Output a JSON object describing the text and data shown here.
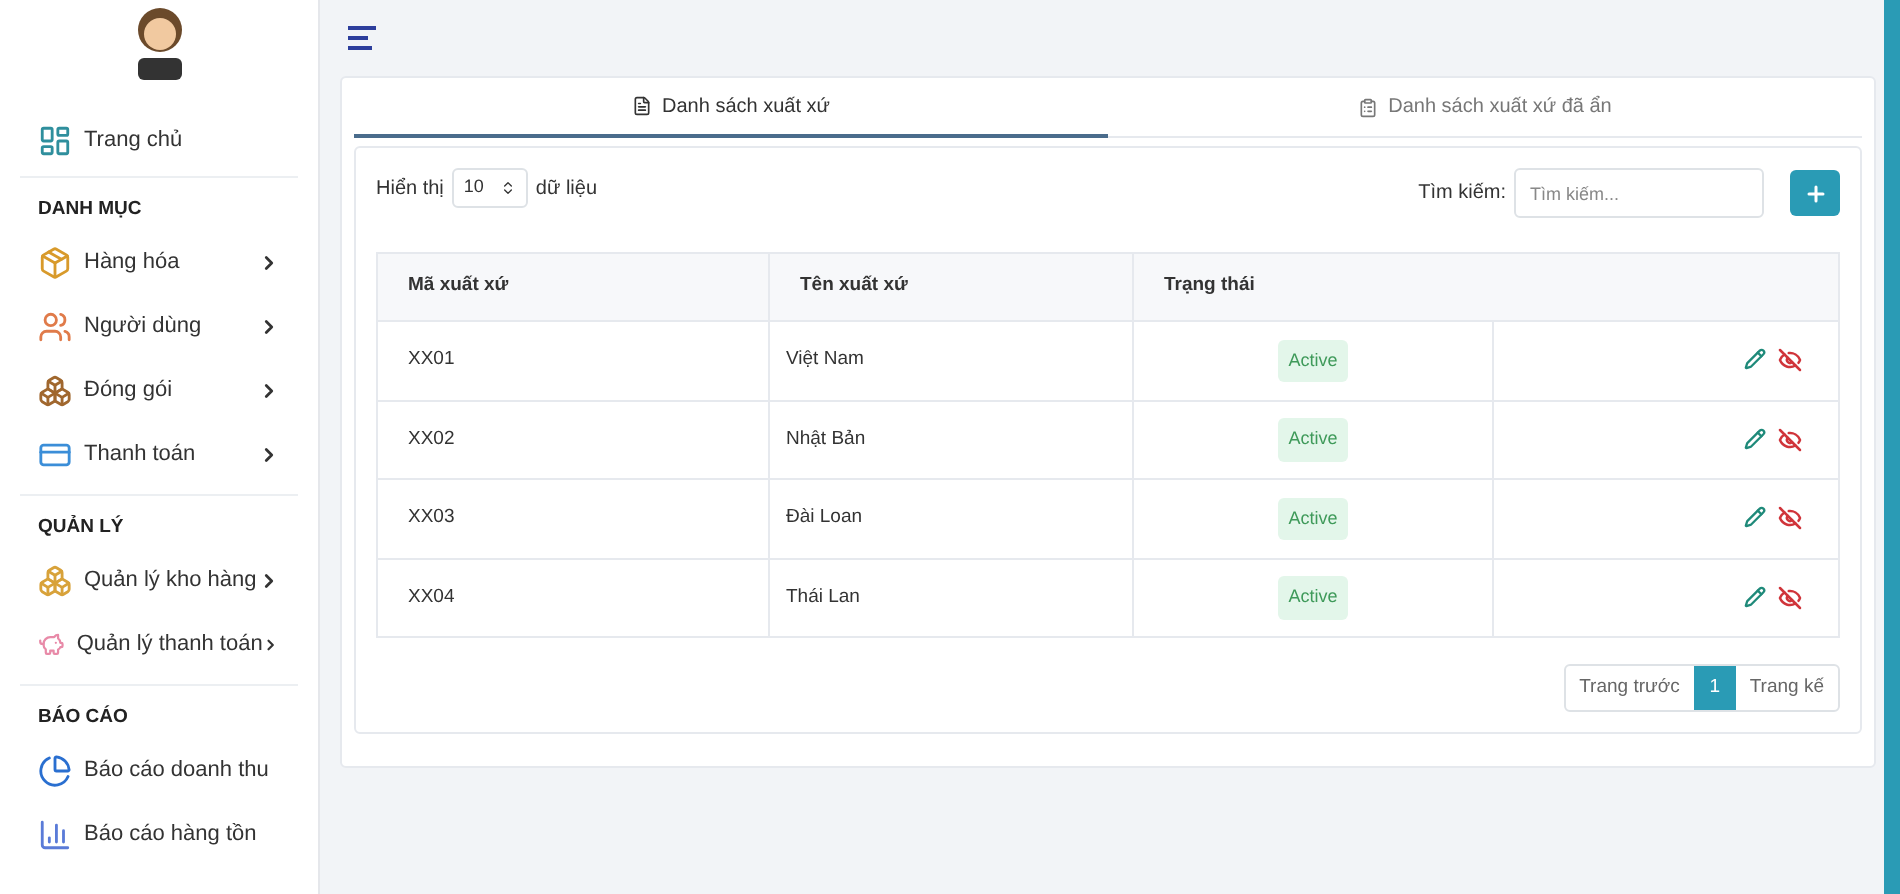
{
  "sidebar": {
    "home": {
      "label": "Trang chủ"
    },
    "sections": [
      {
        "title": "DANH MỤC",
        "items": [
          {
            "label": "Hàng hóa",
            "has_submenu": true
          },
          {
            "label": "Người dùng",
            "has_submenu": true
          },
          {
            "label": "Đóng gói",
            "has_submenu": true
          },
          {
            "label": "Thanh toán",
            "has_submenu": true
          }
        ]
      },
      {
        "title": "QUẢN LÝ",
        "items": [
          {
            "label": "Quản lý kho hàng",
            "has_submenu": true
          },
          {
            "label": "Quản lý thanh toán",
            "has_submenu": true
          }
        ]
      },
      {
        "title": "BÁO CÁO",
        "items": [
          {
            "label": "Báo cáo doanh thu",
            "has_submenu": false
          },
          {
            "label": "Báo cáo hàng tồn",
            "has_submenu": false
          }
        ]
      }
    ]
  },
  "tabs": [
    {
      "label": "Danh sách xuất xứ",
      "selected": true
    },
    {
      "label": "Danh sách xuất xứ đã ẩn",
      "selected": false
    }
  ],
  "controls": {
    "show_label": "Hiển thị",
    "page_size": "10",
    "show_suffix": "dữ liệu",
    "search_label": "Tìm kiếm:",
    "search_placeholder": "Tìm kiếm..."
  },
  "table": {
    "columns": [
      "Mã xuất xứ",
      "Tên xuất xứ",
      "Trạng thái"
    ],
    "rows": [
      {
        "code": "XX01",
        "name": "Việt Nam",
        "status": "Active",
        "kind": "active"
      },
      {
        "code": "XX02",
        "name": "Nhật Bản",
        "status": "Active",
        "kind": "active"
      },
      {
        "code": "XX03",
        "name": "Đài Loan",
        "status": "Active",
        "kind": "active"
      },
      {
        "code": "XX04",
        "name": "Thái Lan",
        "status": "Active",
        "kind": "active"
      }
    ]
  },
  "pagination": {
    "prev": "Trang trước",
    "next": "Trang kế",
    "pages": [
      {
        "label": "1",
        "selected": true
      }
    ]
  }
}
